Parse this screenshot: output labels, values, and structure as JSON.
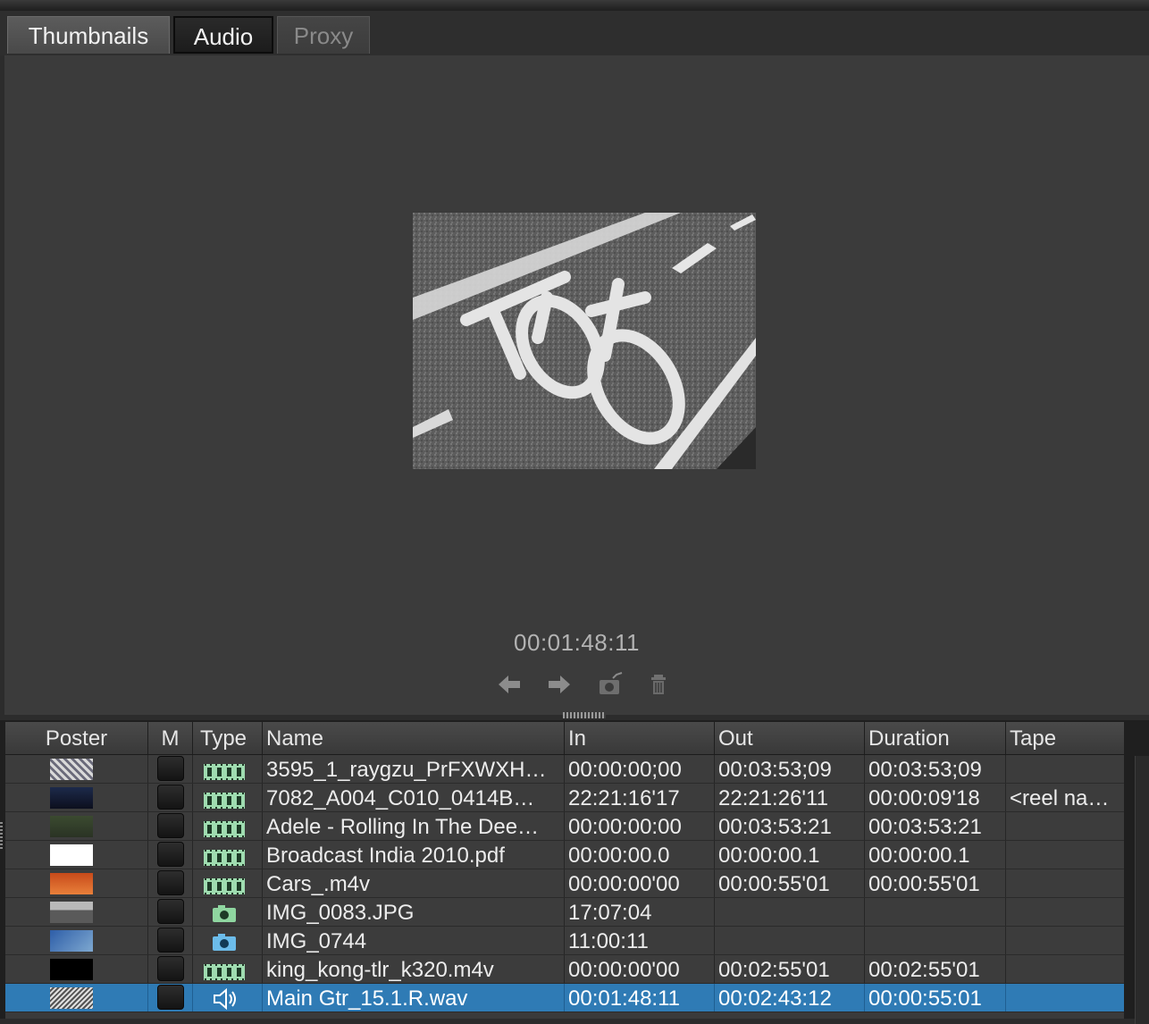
{
  "tabs": [
    {
      "label": "Thumbnails"
    },
    {
      "label": "Audio"
    },
    {
      "label": "Proxy"
    }
  ],
  "preview": {
    "timecode": "00:01:48:11",
    "controls": [
      "previous-arrow-icon",
      "next-arrow-icon",
      "set-poster-camera-icon",
      "trash-icon"
    ]
  },
  "columns": {
    "poster": "Poster",
    "m": "M",
    "type": "Type",
    "name": "Name",
    "in": "In",
    "out": "Out",
    "duration": "Duration",
    "tape": "Tape"
  },
  "rows": [
    {
      "poster": "thumb-noise",
      "type": "film-strip-icon",
      "name": "3595_1_raygzu_PrFXWXH…",
      "in": "00:00:00;00",
      "out": "00:03:53;09",
      "duration": "00:03:53;09",
      "tape": ""
    },
    {
      "poster": "thumb-night",
      "type": "film-strip-icon",
      "name": "7082_A004_C010_0414B…",
      "in": "22:21:16'17",
      "out": "22:21:26'11",
      "duration": "00:00:09'18",
      "tape": "<reel na…"
    },
    {
      "poster": "thumb-forest",
      "type": "film-strip-icon",
      "name": "Adele - Rolling In The Dee…",
      "in": "00:00:00:00",
      "out": "00:03:53:21",
      "duration": "00:03:53:21",
      "tape": ""
    },
    {
      "poster": "thumb-document",
      "type": "film-strip-icon",
      "name": "Broadcast India 2010.pdf",
      "in": "00:00:00.0",
      "out": "00:00:00.1",
      "duration": "00:00:00.1",
      "tape": ""
    },
    {
      "poster": "thumb-orange",
      "type": "film-strip-icon",
      "name": "Cars_.m4v",
      "in": "00:00:00'00",
      "out": "00:00:55'01",
      "duration": "00:00:55'01",
      "tape": ""
    },
    {
      "poster": "thumb-landscape",
      "type": "camera-green-icon",
      "name": "IMG_0083.JPG",
      "in": "17:07:04",
      "out": "",
      "duration": "",
      "tape": ""
    },
    {
      "poster": "thumb-blue",
      "type": "camera-blue-icon",
      "name": "IMG_0744",
      "in": "11:00:11",
      "out": "",
      "duration": "",
      "tape": ""
    },
    {
      "poster": "thumb-black",
      "type": "film-strip-icon",
      "name": "king_kong-tlr_k320.m4v",
      "in": "00:00:00'00",
      "out": "00:02:55'01",
      "duration": "00:02:55'01",
      "tape": ""
    },
    {
      "poster": "thumb-audio",
      "type": "speaker-icon",
      "name": "Main Gtr_15.1.R.wav",
      "in": "00:01:48:11",
      "out": "00:02:43:12",
      "duration": "00:00:55:01",
      "tape": "",
      "selected": true
    }
  ],
  "colors": {
    "selection": "#2f7bb5",
    "film_icon": "#9fdcb0",
    "camera_green": "#8fd6a0",
    "camera_blue": "#6cbcea"
  }
}
